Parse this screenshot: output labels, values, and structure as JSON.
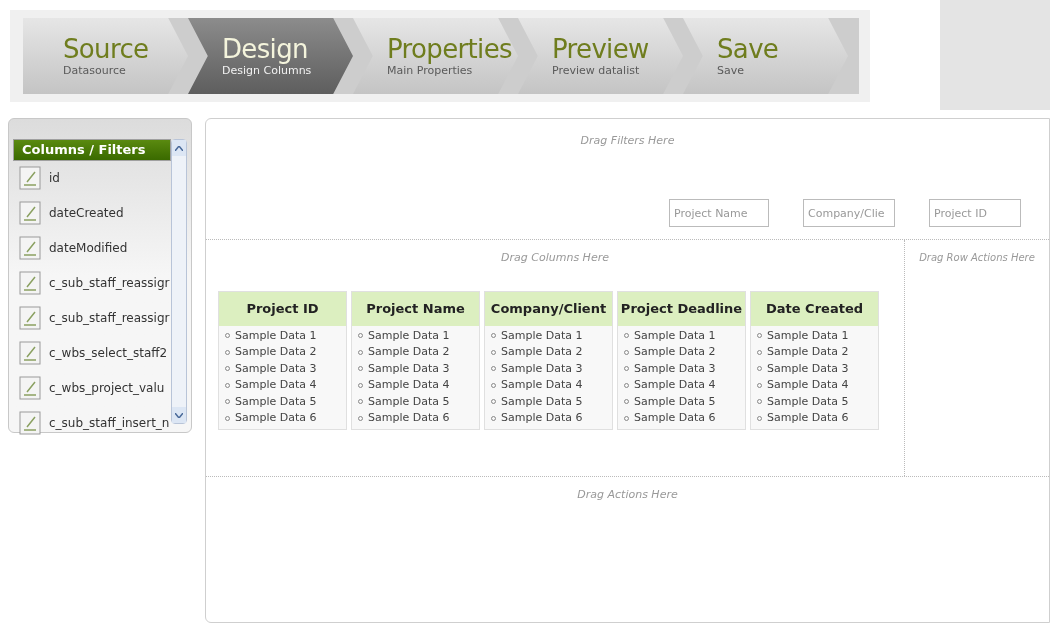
{
  "wizard": {
    "steps": [
      {
        "title": "Source",
        "subtitle": "Datasource",
        "selected": false
      },
      {
        "title": "Design",
        "subtitle": "Design Columns",
        "selected": true
      },
      {
        "title": "Properties",
        "subtitle": "Main Properties",
        "selected": false
      },
      {
        "title": "Preview",
        "subtitle": "Preview datalist",
        "selected": false
      },
      {
        "title": "Save",
        "subtitle": "Save",
        "selected": false
      }
    ]
  },
  "sidebar": {
    "header": "Columns / Filters",
    "items": [
      "id",
      "dateCreated",
      "dateModified",
      "c_sub_staff_reassigr",
      "c_sub_staff_reassigr",
      "c_wbs_select_staff2",
      "c_wbs_project_valu",
      "c_sub_staff_insert_n"
    ]
  },
  "designer": {
    "filters_hint": "Drag Filters Here",
    "filters": [
      {
        "placeholder": "Project Name"
      },
      {
        "placeholder": "Company/Clie"
      },
      {
        "placeholder": "Project ID"
      }
    ],
    "columns_hint": "Drag Columns Here",
    "row_actions_hint": "Drag Row Actions Here",
    "columns": [
      {
        "header": "Project ID",
        "rows": [
          "Sample Data 1",
          "Sample Data 2",
          "Sample Data 3",
          "Sample Data 4",
          "Sample Data 5",
          "Sample Data 6"
        ]
      },
      {
        "header": "Project Name",
        "rows": [
          "Sample Data 1",
          "Sample Data 2",
          "Sample Data 3",
          "Sample Data 4",
          "Sample Data 5",
          "Sample Data 6"
        ]
      },
      {
        "header": "Company/Client",
        "rows": [
          "Sample Data 1",
          "Sample Data 2",
          "Sample Data 3",
          "Sample Data 4",
          "Sample Data 5",
          "Sample Data 6"
        ]
      },
      {
        "header": "Project Deadline",
        "rows": [
          "Sample Data 1",
          "Sample Data 2",
          "Sample Data 3",
          "Sample Data 4",
          "Sample Data 5",
          "Sample Data 6"
        ]
      },
      {
        "header": "Date Created",
        "rows": [
          "Sample Data 1",
          "Sample Data 2",
          "Sample Data 3",
          "Sample Data 4",
          "Sample Data 5",
          "Sample Data 6"
        ]
      }
    ],
    "actions_hint": "Drag Actions Here"
  }
}
